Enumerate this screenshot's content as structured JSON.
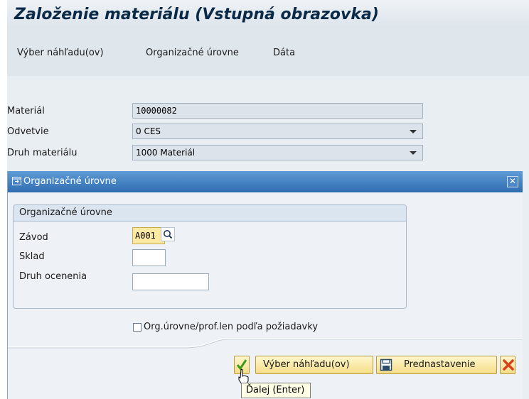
{
  "window": {
    "title": "Založenie materiálu (Vstupná obrazovka)"
  },
  "menu": {
    "items": [
      "Výber náhľadu(ov)",
      "Organizačné úrovne",
      "Dáta"
    ]
  },
  "form": {
    "material_label": "Materiál",
    "material_value": "10000082",
    "industry_label": "Odvetvie",
    "industry_value": "0 CES",
    "material_type_label": "Druh materiálu",
    "material_type_value": "1000 Materiál"
  },
  "dialog": {
    "title": "Organizačné úrovne",
    "close_icon": "close-icon",
    "group": {
      "title": "Organizačné úrovne",
      "plant_label": "Závod",
      "plant_value": "A001",
      "storage_label": "Sklad",
      "storage_value": "",
      "valuation_label": "Druh ocenenia",
      "valuation_value": ""
    },
    "checkbox_label": "Org.úrovne/prof.len podľa požiadavky",
    "checkbox_checked": false,
    "buttons": {
      "continue_icon": "checkmark-icon",
      "views_label": "Výber náhľadu(ov)",
      "default_label": "Prednastavenie",
      "default_icon": "save-icon",
      "cancel_icon": "cancel-icon"
    },
    "tooltip": "Ďalej   (Enter)"
  },
  "colors": {
    "title_text": "#0b2a48",
    "dialog_title_bar": "#2e6db2",
    "button_yellow": "#f5dd88",
    "input_highlight": "#fbe9a4",
    "cancel_red": "#d9401a",
    "check_green": "#3c9a1e"
  }
}
